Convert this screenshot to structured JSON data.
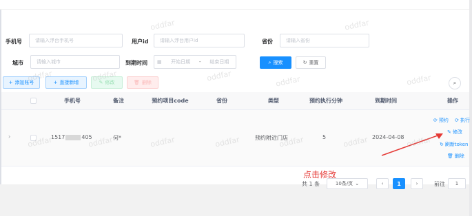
{
  "search_form": {
    "phone_label": "手机号",
    "phone_placeholder": "请输入浮台手机号",
    "userid_label": "用户id",
    "userid_placeholder": "请输入浮台用户id",
    "province_label": "省份",
    "province_placeholder": "请输入省份",
    "city_label": "城市",
    "city_placeholder": "请输入城市",
    "expire_label": "到期时间",
    "date_start_placeholder": "开始日期",
    "date_separator": "-",
    "date_end_placeholder": "结束日期",
    "search_button": "搜索",
    "reset_button": "重置"
  },
  "toolbar": {
    "add_account": "添加账号",
    "direct_add": "直接新增",
    "edit": "修改",
    "delete": "删除"
  },
  "table": {
    "columns": [
      "手机号",
      "备注",
      "预约项目code",
      "省份",
      "类型",
      "预约执行分钟",
      "到期时间",
      "操作"
    ],
    "rows": [
      {
        "phone_prefix": "1517",
        "phone_suffix": "405",
        "remark": "何*",
        "code": "",
        "province": "",
        "type": "预约附近门店",
        "minutes": "5",
        "expire": "2024-04-08",
        "ops": [
          "预约",
          "执行",
          "修改",
          "刷新token",
          "删除"
        ]
      }
    ]
  },
  "annotation": {
    "text": "点击修改",
    "color": "#e53935"
  },
  "pagination": {
    "total_text": "共 1 条",
    "page_size": "10条/页",
    "current_page": "1",
    "goto_label": "前往",
    "goto_value": "1"
  },
  "watermark": "oddfar",
  "colors": {
    "primary": "#1890ff",
    "annotation_red": "#e53935"
  }
}
